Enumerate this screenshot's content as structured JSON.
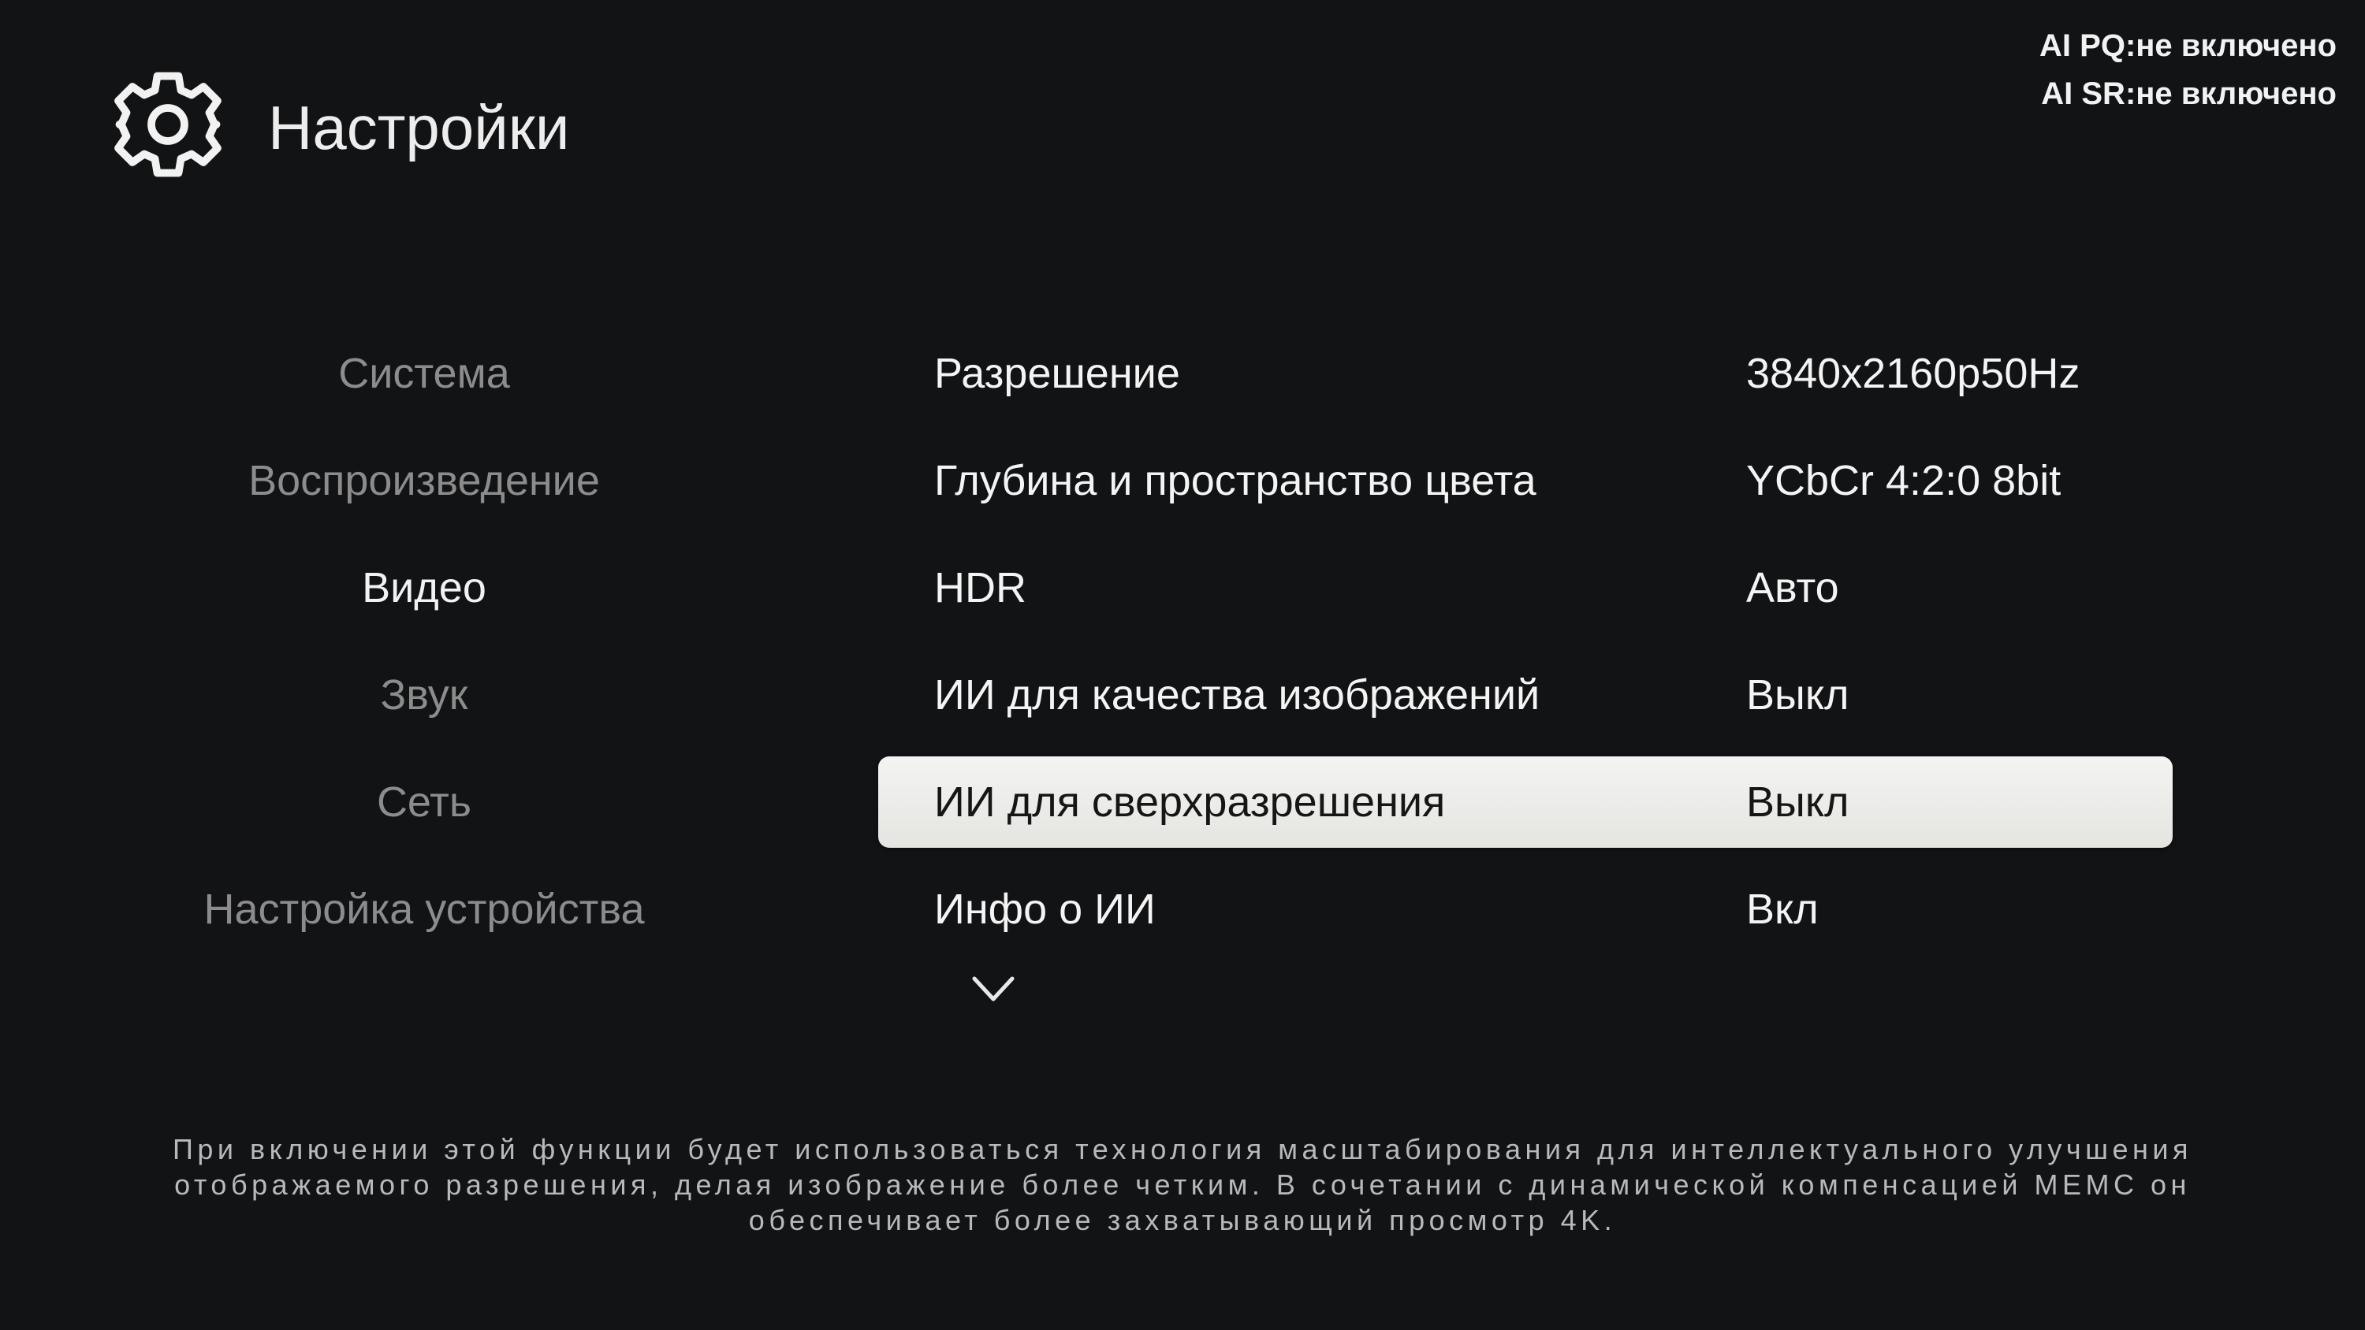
{
  "header": {
    "title": "Настройки",
    "icon": "gear-icon"
  },
  "ai_status": {
    "pq": "AI PQ:не включено",
    "sr": "AI SR:не включено"
  },
  "categories": [
    {
      "label": "Система",
      "active": false
    },
    {
      "label": "Воспроизведение",
      "active": false
    },
    {
      "label": "Видео",
      "active": true
    },
    {
      "label": "Звук",
      "active": false
    },
    {
      "label": "Сеть",
      "active": false
    },
    {
      "label": "Настройка устройства",
      "active": false
    }
  ],
  "options": [
    {
      "label": "Разрешение",
      "value": "3840x2160p50Hz",
      "selected": false
    },
    {
      "label": "Глубина и пространство цвета",
      "value": "YCbCr 4:2:0 8bit",
      "selected": false
    },
    {
      "label": "HDR",
      "value": "Авто",
      "selected": false
    },
    {
      "label": "ИИ для качества изображений",
      "value": "Выкл",
      "selected": false
    },
    {
      "label": "ИИ для сверхразрешения",
      "value": "Выкл",
      "selected": true
    },
    {
      "label": "Инфо о ИИ",
      "value": "Вкл",
      "selected": false
    }
  ],
  "more_indicator": "chevron-down-icon",
  "description": "При включении этой функции будет использоваться технология масштабирования для интеллектуального улучшения отображаемого разрешения, делая изображение более четким. В сочетании с динамической компенсацией MEMC он обеспечивает более захватывающий просмотр 4K.",
  "colors": {
    "background": "#121315",
    "text_primary": "#f4f4f4",
    "text_inactive": "#8c8c8c",
    "selection": "#efefec",
    "selection_text": "#161616",
    "description": "#b9b9b9"
  }
}
